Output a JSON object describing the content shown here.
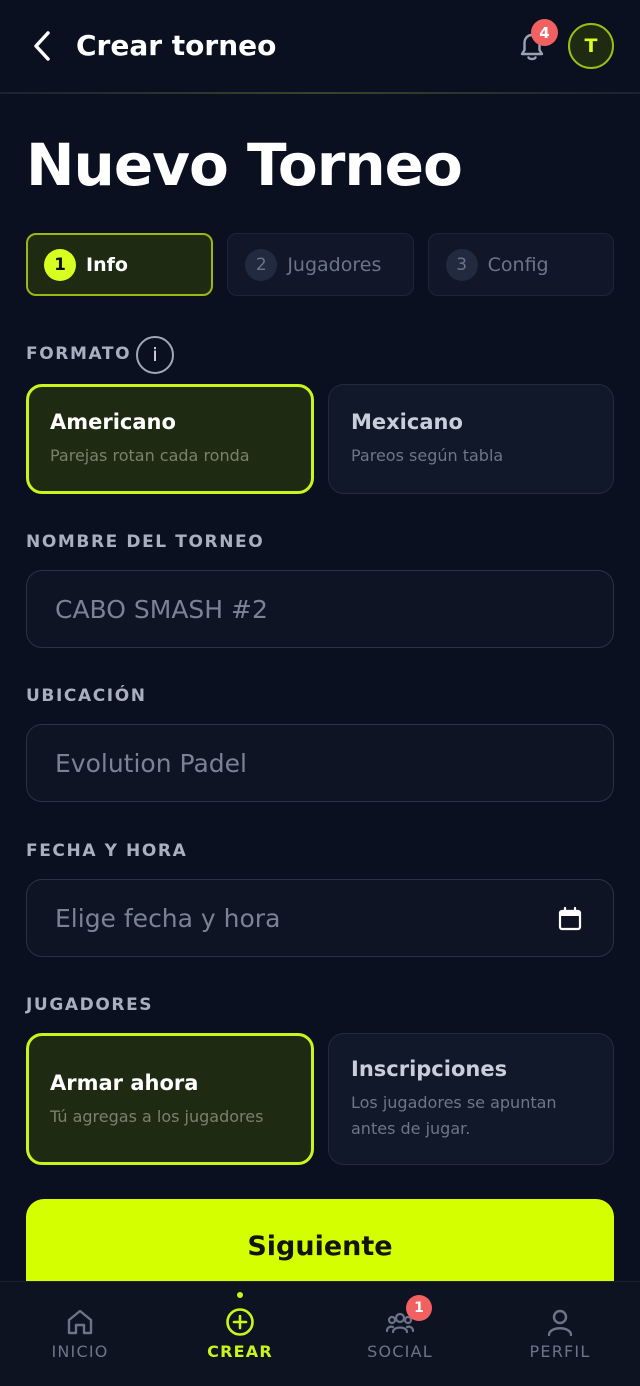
{
  "header": {
    "title": "Crear torneo",
    "notifications_count": "4",
    "avatar_initial": "T"
  },
  "page_title": "Nuevo Torneo",
  "steps": [
    {
      "number": "1",
      "label": "Info",
      "active": true
    },
    {
      "number": "2",
      "label": "Jugadores",
      "active": false
    },
    {
      "number": "3",
      "label": "Config",
      "active": false
    }
  ],
  "formato": {
    "label": "FORMATO",
    "info_icon": "i",
    "options": [
      {
        "title": "Americano",
        "subtitle": "Parejas rotan cada ronda",
        "selected": true
      },
      {
        "title": "Mexicano",
        "subtitle": "Pareos según tabla",
        "selected": false
      }
    ]
  },
  "nombre": {
    "label": "NOMBRE DEL TORNEO",
    "value": "CABO SMASH #2"
  },
  "ubicacion": {
    "label": "UBICACIÓN",
    "value": "Evolution Padel"
  },
  "fecha": {
    "label": "FECHA Y HORA",
    "placeholder": "Elige fecha y hora",
    "icon": "calendar-icon"
  },
  "jugadores": {
    "label": "JUGADORES",
    "options": [
      {
        "title": "Armar ahora",
        "subtitle": "Tú agregas a los jugadores",
        "selected": true
      },
      {
        "title": "Inscripciones",
        "subtitle": "Los jugadores se apuntan antes de jugar.",
        "selected": false
      }
    ]
  },
  "next_button": "Siguiente",
  "bottom_nav": [
    {
      "label": "INICIO",
      "icon": "home-icon",
      "active": false
    },
    {
      "label": "CREAR",
      "icon": "plus-circle-icon",
      "active": true
    },
    {
      "label": "SOCIAL",
      "icon": "people-icon",
      "active": false,
      "badge": "1"
    },
    {
      "label": "PERFIL",
      "icon": "user-icon",
      "active": false
    }
  ],
  "colors": {
    "background": "#0b1020",
    "accent": "#d4ff00",
    "badge": "#f16161"
  }
}
